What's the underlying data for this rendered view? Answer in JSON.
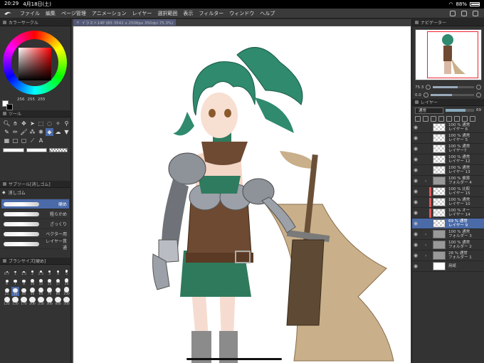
{
  "status": {
    "time": "20:29",
    "date": "4月18日(土)",
    "battery": "88%",
    "battery_level": 0.88
  },
  "menu": [
    "ファイル",
    "編集",
    "ページ管理",
    "アニメーション",
    "レイヤー",
    "選択範囲",
    "表示",
    "フィルター",
    "ウィンドウ",
    "ヘルプ"
  ],
  "color_panel": {
    "title": "カラーサークル",
    "h": "256",
    "s": "255",
    "v": "255",
    "main_color": "#ffffff",
    "sub_color": "#000000",
    "hue": "#ff0000"
  },
  "tool_panel": {
    "title": "ツール"
  },
  "subtool_panel": {
    "title": "サブツール[消しゴム]",
    "group": "消しゴム",
    "items": [
      {
        "label": "硬め"
      },
      {
        "label": "粗らかめ"
      },
      {
        "label": "ざっくり"
      },
      {
        "label": "ベクター用"
      },
      {
        "label": "レイヤー貫通"
      }
    ]
  },
  "brush_size_panel": {
    "title": "ブラシサイズ[硬め]",
    "sizes": [
      "0.7",
      "1",
      "1.5",
      "2",
      "2.5",
      "3",
      "4",
      "5",
      "6",
      "7",
      "8",
      "10",
      "12",
      "15",
      "17",
      "20",
      "25",
      "30",
      "40",
      "50",
      "60",
      "70",
      "80",
      "100",
      "120",
      "150",
      "170",
      "200",
      "250",
      "300",
      "400",
      "500"
    ]
  },
  "document_tab": {
    "label": "イラスト14P (B5 3541 x 2508px 350dpi 75.3%)"
  },
  "navigator": {
    "title": "ナビゲーター",
    "zoom": "75.3",
    "rotate": "0.0"
  },
  "layer_panel": {
    "title": "レイヤー",
    "blend": "通常",
    "opacity": "69",
    "opacity_level": 0.69,
    "layers": [
      {
        "pct": "100 % 通常",
        "name": "レイヤー 6",
        "type": "layer"
      },
      {
        "pct": "100 % 通常",
        "name": "レイヤー 5",
        "type": "layer"
      },
      {
        "pct": "100 % 通常",
        "name": "レイヤー7",
        "type": "layer"
      },
      {
        "pct": "100 % 通常",
        "name": "レイヤー 12",
        "type": "layer"
      },
      {
        "pct": "100 % 通常",
        "name": "レイヤー 13",
        "type": "layer"
      },
      {
        "pct": "100 % 乗算",
        "name": "フォルダー 4",
        "type": "folder"
      },
      {
        "pct": "100 % 比較",
        "name": "レイヤー 15",
        "type": "layer"
      },
      {
        "pct": "100 % 通常",
        "name": "レイヤー 10",
        "type": "layer"
      },
      {
        "pct": "100 % オー",
        "name": "レイヤー 14",
        "type": "layer"
      },
      {
        "pct": "69 % 通常",
        "name": "レイヤー 9",
        "type": "layer",
        "selected": true
      },
      {
        "pct": "100 % 通常",
        "name": "フォルダー 3",
        "type": "folder"
      },
      {
        "pct": "100 % 通常",
        "name": "フォルダー 2",
        "type": "folder"
      },
      {
        "pct": "28 % 通常",
        "name": "フォルダー 1",
        "type": "folder"
      },
      {
        "pct": "",
        "name": "用紙",
        "type": "paper"
      }
    ]
  }
}
